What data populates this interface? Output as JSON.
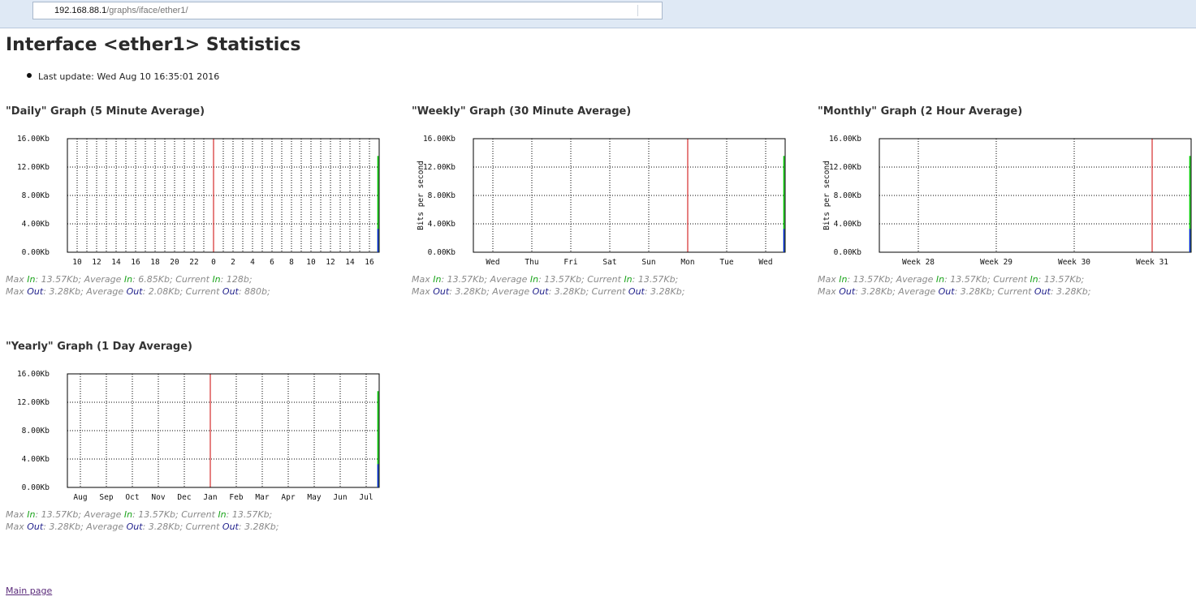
{
  "browser": {
    "url_host": "192.168.88.1",
    "url_path": "/graphs/iface/ether1/"
  },
  "page": {
    "title": "Interface <ether1> Statistics",
    "last_update": "Last update: Wed Aug 10 16:35:01 2016",
    "main_page_link": "Main page"
  },
  "colors": {
    "in_line": "#00cc00",
    "out_line": "#0000ff",
    "now_marker": "#cc0000",
    "grid": "#000000",
    "in_label": "#1aa31a",
    "out_label": "#1d1d8a"
  },
  "graphs": [
    {
      "title": "\"Daily\" Graph (5 Minute Average)",
      "stats": {
        "in": {
          "max": "13.57Kb",
          "average": "6.85Kb",
          "current": "128b"
        },
        "out": {
          "max": "3.28Kb",
          "average": "2.08Kb",
          "current": "880b"
        }
      }
    },
    {
      "title": "\"Weekly\" Graph (30 Minute Average)",
      "stats": {
        "in": {
          "max": "13.57Kb",
          "average": "13.57Kb",
          "current": "13.57Kb"
        },
        "out": {
          "max": "3.28Kb",
          "average": "3.28Kb",
          "current": "3.28Kb"
        }
      }
    },
    {
      "title": "\"Monthly\" Graph (2 Hour Average)",
      "stats": {
        "in": {
          "max": "13.57Kb",
          "average": "13.57Kb",
          "current": "13.57Kb"
        },
        "out": {
          "max": "3.28Kb",
          "average": "3.28Kb",
          "current": "3.28Kb"
        }
      }
    },
    {
      "title": "\"Yearly\" Graph (1 Day Average)",
      "stats": {
        "in": {
          "max": "13.57Kb",
          "average": "13.57Kb",
          "current": "13.57Kb"
        },
        "out": {
          "max": "3.28Kb",
          "average": "3.28Kb",
          "current": "3.28Kb"
        }
      }
    }
  ],
  "stat_words": {
    "max": "Max",
    "average": "Average",
    "current": "Current",
    "in": "In",
    "out": "Out"
  },
  "chart_data": [
    {
      "type": "line",
      "y_tick_labels": [
        "0.00Kb",
        "4.00Kb",
        "8.00Kb",
        "12.00Kb",
        "16.00Kb"
      ],
      "ylim": [
        0,
        16
      ],
      "ylabel": "",
      "x_tick_labels": [
        "10",
        "12",
        "14",
        "16",
        "18",
        "20",
        "22",
        "0",
        "2",
        "4",
        "6",
        "8",
        "10",
        "12",
        "14",
        "16"
      ],
      "now_marker_after_label": "22",
      "series": [
        {
          "name": "In",
          "color": "#00cc00",
          "values": [
            13.57
          ]
        },
        {
          "name": "Out",
          "color": "#0000ff",
          "values": [
            3.28
          ]
        }
      ]
    },
    {
      "type": "line",
      "y_tick_labels": [
        "0.00Kb",
        "4.00Kb",
        "8.00Kb",
        "12.00Kb",
        "16.00Kb"
      ],
      "ylim": [
        0,
        16
      ],
      "ylabel": "Bits per second",
      "x_tick_labels": [
        "Wed",
        "Thu",
        "Fri",
        "Sat",
        "Sun",
        "Mon",
        "Tue",
        "Wed"
      ],
      "now_marker_after_label": "Sun",
      "series": [
        {
          "name": "In",
          "color": "#00cc00",
          "values": [
            13.57
          ]
        },
        {
          "name": "Out",
          "color": "#0000ff",
          "values": [
            3.28
          ]
        }
      ]
    },
    {
      "type": "line",
      "y_tick_labels": [
        "0.00Kb",
        "4.00Kb",
        "8.00Kb",
        "12.00Kb",
        "16.00Kb"
      ],
      "ylim": [
        0,
        16
      ],
      "ylabel": "Bits per second",
      "x_tick_labels": [
        "Week 28",
        "Week 29",
        "Week 30",
        "Week 31"
      ],
      "now_marker_after_label": "Week 30",
      "series": [
        {
          "name": "In",
          "color": "#00cc00",
          "values": [
            13.57
          ]
        },
        {
          "name": "Out",
          "color": "#0000ff",
          "values": [
            3.28
          ]
        }
      ]
    },
    {
      "type": "line",
      "y_tick_labels": [
        "0.00Kb",
        "4.00Kb",
        "8.00Kb",
        "12.00Kb",
        "16.00Kb"
      ],
      "ylim": [
        0,
        16
      ],
      "ylabel": "",
      "x_tick_labels": [
        "Aug",
        "Sep",
        "Oct",
        "Nov",
        "Dec",
        "Jan",
        "Feb",
        "Mar",
        "Apr",
        "May",
        "Jun",
        "Jul"
      ],
      "now_marker_after_label": "Dec",
      "series": [
        {
          "name": "In",
          "color": "#00cc00",
          "values": [
            13.57
          ]
        },
        {
          "name": "Out",
          "color": "#0000ff",
          "values": [
            3.28
          ]
        }
      ]
    }
  ]
}
